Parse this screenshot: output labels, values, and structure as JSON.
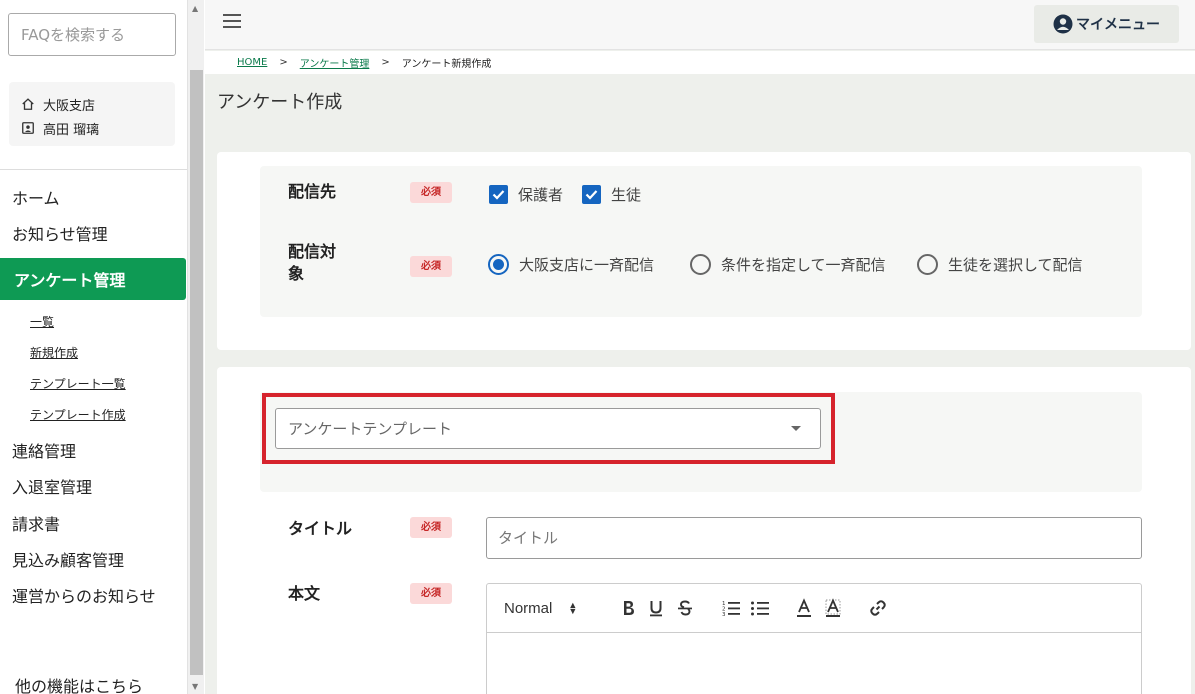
{
  "sidebar": {
    "faq_placeholder": "FAQを検索する",
    "branch": "大阪支店",
    "user": "高田 瑠璃",
    "nav": {
      "home": "ホーム",
      "notices": "お知らせ管理",
      "survey": "アンケート管理",
      "sub_list": "一覧",
      "sub_new": "新規作成",
      "sub_template_list": "テンプレート一覧",
      "sub_template_new": "テンプレート作成",
      "contact": "連絡管理",
      "entry_exit": "入退室管理",
      "invoice": "請求書",
      "prospects": "見込み顧客管理",
      "ops_news": "運営からのお知らせ",
      "other": "他の機能はこちら"
    },
    "accent_color": "#0e9a54"
  },
  "header": {
    "my_menu": "マイメニュー"
  },
  "breadcrumb": {
    "home": "HOME",
    "survey": "アンケート管理",
    "current": "アンケート新規作成",
    "sep": ">"
  },
  "page": {
    "title": "アンケート作成"
  },
  "form": {
    "required_badge": "必須",
    "destination_label": "配信先",
    "destination_options": [
      "保護者",
      "生徒"
    ],
    "target_label_line1": "配信対",
    "target_label_line2": "象",
    "target_options": [
      "大阪支店に一斉配信",
      "条件を指定して一斉配信",
      "生徒を選択して配信"
    ],
    "target_selected": "大阪支店に一斉配信",
    "template_placeholder": "アンケートテンプレート",
    "title_label": "タイトル",
    "title_placeholder": "タイトル",
    "body_label": "本文",
    "editor_format": "Normal",
    "highlight_color": "#d6232c"
  }
}
